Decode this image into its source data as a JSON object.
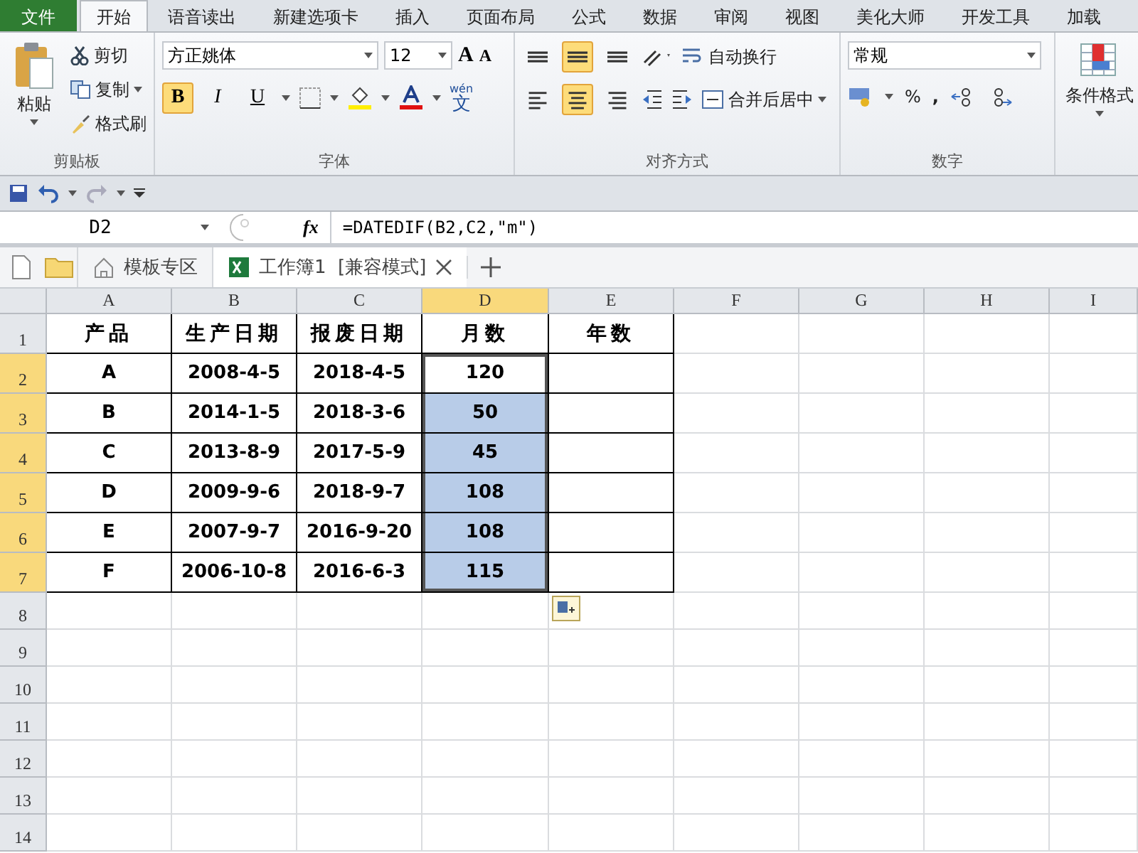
{
  "ribbon": {
    "tabs": [
      {
        "label": "文件",
        "kind": "file",
        "selected": false
      },
      {
        "label": "开始",
        "kind": "tab",
        "selected": true
      },
      {
        "label": "语音读出",
        "kind": "tab",
        "selected": false
      },
      {
        "label": "新建选项卡",
        "kind": "tab",
        "selected": false
      },
      {
        "label": "插入",
        "kind": "tab",
        "selected": false
      },
      {
        "label": "页面布局",
        "kind": "tab",
        "selected": false
      },
      {
        "label": "公式",
        "kind": "tab",
        "selected": false
      },
      {
        "label": "数据",
        "kind": "tab",
        "selected": false
      },
      {
        "label": "审阅",
        "kind": "tab",
        "selected": false
      },
      {
        "label": "视图",
        "kind": "tab",
        "selected": false
      },
      {
        "label": "美化大师",
        "kind": "tab",
        "selected": false
      },
      {
        "label": "开发工具",
        "kind": "tab",
        "selected": false
      },
      {
        "label": "加载",
        "kind": "tab",
        "selected": false
      }
    ],
    "clipboard": {
      "label": "剪贴板",
      "paste": "粘贴",
      "cut": "剪切",
      "copy": "复制",
      "format_painter": "格式刷"
    },
    "font": {
      "label": "字体",
      "font_name": "方正姚体",
      "font_size": "12",
      "grow": "A",
      "shrink": "A",
      "styles": [
        {
          "kind": "bold",
          "label": "B",
          "selected": true
        },
        {
          "kind": "italic",
          "label": "I",
          "selected": false
        },
        {
          "kind": "underline",
          "label": "U",
          "selected": false
        }
      ],
      "phonetic": {
        "pinyin": "wén",
        "char": "文"
      }
    },
    "alignment": {
      "label": "对齐方式",
      "wrap": "自动换行",
      "merge": "合并后居中",
      "buttons": [
        {
          "kind": "top",
          "selected": false
        },
        {
          "kind": "middle",
          "selected": true
        },
        {
          "kind": "bottom",
          "selected": false
        },
        {
          "kind": "left",
          "selected": false
        },
        {
          "kind": "center",
          "selected": true
        },
        {
          "kind": "right",
          "selected": false
        }
      ]
    },
    "number": {
      "label": "数字",
      "format": "常规",
      "percent": "%",
      "comma": ","
    },
    "styles": {
      "conditional": "条件格式"
    }
  },
  "formula_bar": {
    "name_box": "D2",
    "fx": "fx",
    "formula": "=DATEDIF(B2,C2,\"m\")"
  },
  "doc_tabs": [
    {
      "kind": "home",
      "label": "模板专区",
      "selected": false
    },
    {
      "kind": "workbook",
      "label": "工作簿1  [兼容模式]",
      "selected": true
    }
  ],
  "sheet": {
    "columns": [
      {
        "label": "A",
        "selected": false
      },
      {
        "label": "B",
        "selected": false
      },
      {
        "label": "C",
        "selected": false
      },
      {
        "label": "D",
        "selected": true
      },
      {
        "label": "E",
        "selected": false
      },
      {
        "label": "F",
        "selected": false
      },
      {
        "label": "G",
        "selected": false
      },
      {
        "label": "H",
        "selected": false
      },
      {
        "label": "I",
        "selected": false
      }
    ],
    "rows": [
      {
        "number": "1",
        "selected": false,
        "cells": [
          {
            "text": "产品",
            "selected": false,
            "active": false
          },
          {
            "text": "生产日期",
            "selected": false,
            "active": false
          },
          {
            "text": "报废日期",
            "selected": false,
            "active": false
          },
          {
            "text": "月数",
            "selected": false,
            "active": false
          },
          {
            "text": "年数",
            "selected": false,
            "active": false
          }
        ]
      },
      {
        "number": "2",
        "selected": true,
        "cells": [
          {
            "text": "A",
            "selected": false,
            "active": false
          },
          {
            "text": "2008-4-5",
            "selected": false,
            "active": false
          },
          {
            "text": "2018-4-5",
            "selected": false,
            "active": false
          },
          {
            "text": "120",
            "selected": true,
            "active": true
          },
          {
            "text": "",
            "selected": false,
            "active": false
          }
        ]
      },
      {
        "number": "3",
        "selected": true,
        "cells": [
          {
            "text": "B",
            "selected": false,
            "active": false
          },
          {
            "text": "2014-1-5",
            "selected": false,
            "active": false
          },
          {
            "text": "2018-3-6",
            "selected": false,
            "active": false
          },
          {
            "text": "50",
            "selected": true,
            "active": false
          },
          {
            "text": "",
            "selected": false,
            "active": false
          }
        ]
      },
      {
        "number": "4",
        "selected": true,
        "cells": [
          {
            "text": "C",
            "selected": false,
            "active": false
          },
          {
            "text": "2013-8-9",
            "selected": false,
            "active": false
          },
          {
            "text": "2017-5-9",
            "selected": false,
            "active": false
          },
          {
            "text": "45",
            "selected": true,
            "active": false
          },
          {
            "text": "",
            "selected": false,
            "active": false
          }
        ]
      },
      {
        "number": "5",
        "selected": true,
        "cells": [
          {
            "text": "D",
            "selected": false,
            "active": false
          },
          {
            "text": "2009-9-6",
            "selected": false,
            "active": false
          },
          {
            "text": "2018-9-7",
            "selected": false,
            "active": false
          },
          {
            "text": "108",
            "selected": true,
            "active": false
          },
          {
            "text": "",
            "selected": false,
            "active": false
          }
        ]
      },
      {
        "number": "6",
        "selected": true,
        "cells": [
          {
            "text": "E",
            "selected": false,
            "active": false
          },
          {
            "text": "2007-9-7",
            "selected": false,
            "active": false
          },
          {
            "text": "2016-9-20",
            "selected": false,
            "active": false
          },
          {
            "text": "108",
            "selected": true,
            "active": false
          },
          {
            "text": "",
            "selected": false,
            "active": false
          }
        ]
      },
      {
        "number": "7",
        "selected": true,
        "cells": [
          {
            "text": "F",
            "selected": false,
            "active": false
          },
          {
            "text": "2006-10-8",
            "selected": false,
            "active": false
          },
          {
            "text": "2016-6-3",
            "selected": false,
            "active": false
          },
          {
            "text": "115",
            "selected": true,
            "active": false
          },
          {
            "text": "",
            "selected": false,
            "active": false
          }
        ]
      },
      {
        "number": "8",
        "selected": false
      },
      {
        "number": "9",
        "selected": false
      },
      {
        "number": "10",
        "selected": false
      },
      {
        "number": "11",
        "selected": false
      },
      {
        "number": "12",
        "selected": false
      },
      {
        "number": "13",
        "selected": false
      },
      {
        "number": "14",
        "selected": false
      }
    ]
  }
}
